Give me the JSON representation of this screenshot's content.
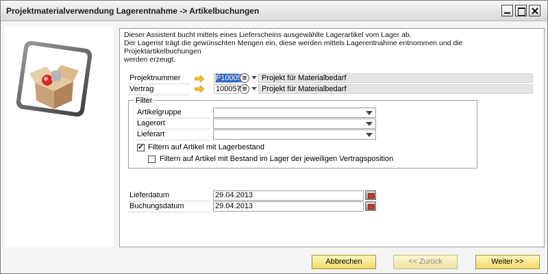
{
  "window": {
    "title": "Projektmaterialverwendung Lagerentnahme -> Artikelbuchungen"
  },
  "sidebar": {
    "logo_icon": "package-with-items-icon"
  },
  "description": {
    "line1": "Dieser Assistent bucht mittels eines Lieferscheins ausgewählte Lagerartikel vom Lager ab.",
    "line2": "Der Lagerist trägt die gewünschten Mengen ein, diese werden mittels Lagerentnahme entnommen und die Projektartikelbuchungen",
    "line3": "werden erzeugt."
  },
  "fields": {
    "projektnummer": {
      "label": "Projektnummer",
      "value": "P100057",
      "description": "Projekt für Materialbedarf"
    },
    "vertrag": {
      "label": "Vertrag",
      "value": "10005700",
      "description": "Projekt für Materialbedarf"
    }
  },
  "filter": {
    "legend": "Filter",
    "artikelgruppe": {
      "label": "Artikelgruppe",
      "value": ""
    },
    "lagerort": {
      "label": "Lagerort",
      "value": ""
    },
    "lieferart": {
      "label": "Lieferart",
      "value": ""
    },
    "check_lagerbestand": {
      "label": "Filtern auf Artikel mit Lagerbestand",
      "checked": true
    },
    "check_vertragsposition": {
      "label": "Filtern auf Artikel mit Bestand im Lager der jeweiligen Vertragsposition",
      "checked": false
    }
  },
  "dates": {
    "lieferdatum": {
      "label": "Lieferdatum",
      "value": "29.04.2013"
    },
    "buchungsdatum": {
      "label": "Buchungsdatum",
      "value": "29.04.2013"
    }
  },
  "buttons": {
    "cancel": "Abbrechen",
    "back": "<< Zurück",
    "next": "Weiter >>"
  },
  "colors": {
    "button_face": "#f0d86b",
    "key_field": "#fff6a8",
    "selection": "#3169c6",
    "link_arrow": "#f2c21b"
  }
}
